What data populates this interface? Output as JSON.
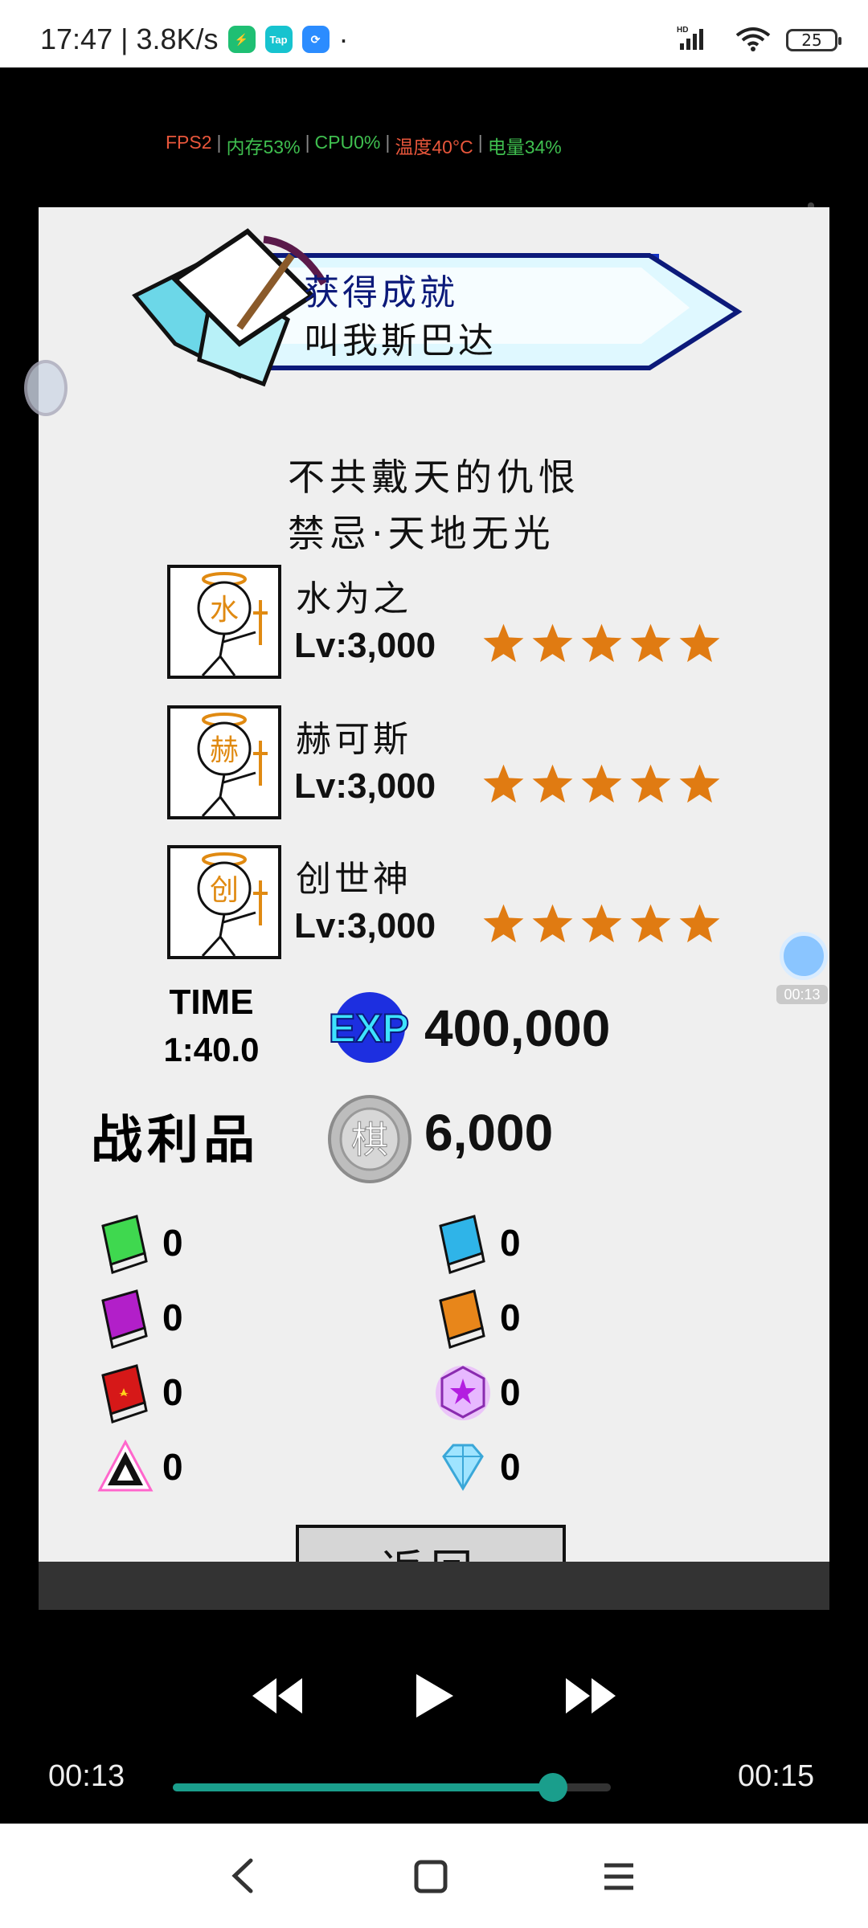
{
  "status_bar": {
    "time_speed": "17:47 | 3.8K/s",
    "dot": "·",
    "network": "HD",
    "battery": "25",
    "apps": [
      {
        "name": "green-app-icon",
        "label": "",
        "color": "#1fbf73"
      },
      {
        "name": "taptap-icon",
        "label": "Tap",
        "color": "#17c3cf"
      },
      {
        "name": "blue-sync-icon",
        "label": "",
        "color": "#2b8cff"
      }
    ]
  },
  "overlay_stats": [
    {
      "text": "FPS2",
      "color": "#e8563b"
    },
    {
      "text": "内存53%",
      "color": "#3fbf4f"
    },
    {
      "text": "CPU0%",
      "color": "#3fbf4f"
    },
    {
      "text": "温度40°C",
      "color": "#e8563b"
    },
    {
      "text": "电量34%",
      "color": "#3fbf4f"
    }
  ],
  "achievement": {
    "title": "获得成就",
    "name": "叫我斯巴达"
  },
  "sublines": [
    "不共戴天的仇恨",
    "禁忌·天地无光"
  ],
  "characters": [
    {
      "glyph": "水",
      "name": "水为之",
      "level": "Lv:3,000",
      "stars": 5
    },
    {
      "glyph": "赫",
      "name": "赫可斯",
      "level": "Lv:3,000",
      "stars": 5
    },
    {
      "glyph": "创",
      "name": "创世神",
      "level": "Lv:3,000",
      "stars": 5
    }
  ],
  "time": {
    "label": "TIME",
    "value": "1:40.0"
  },
  "exp": {
    "badge": "EXP",
    "value": "400,000"
  },
  "loot": {
    "label": "战利品",
    "coin_glyph": "棋",
    "coin_value": "6,000"
  },
  "items": [
    {
      "name": "green-book-icon",
      "count": "0"
    },
    {
      "name": "blue-book-icon",
      "count": "0"
    },
    {
      "name": "purple-book-icon",
      "count": "0"
    },
    {
      "name": "orange-book-icon",
      "count": "0"
    },
    {
      "name": "red-book-icon",
      "count": "0"
    },
    {
      "name": "purple-cube-icon",
      "count": "0"
    },
    {
      "name": "prism-triangle-icon",
      "count": "0"
    },
    {
      "name": "diamond-icon",
      "count": "0"
    }
  ],
  "back_button": "返回",
  "player": {
    "current": "00:13",
    "total": "00:15",
    "progress": 0.867,
    "float_time": "00:13",
    "float_left": "22"
  },
  "colors": {
    "star": "#e07b12",
    "banner_blue": "#0c1a7a",
    "seek": "#1a9e8c"
  }
}
